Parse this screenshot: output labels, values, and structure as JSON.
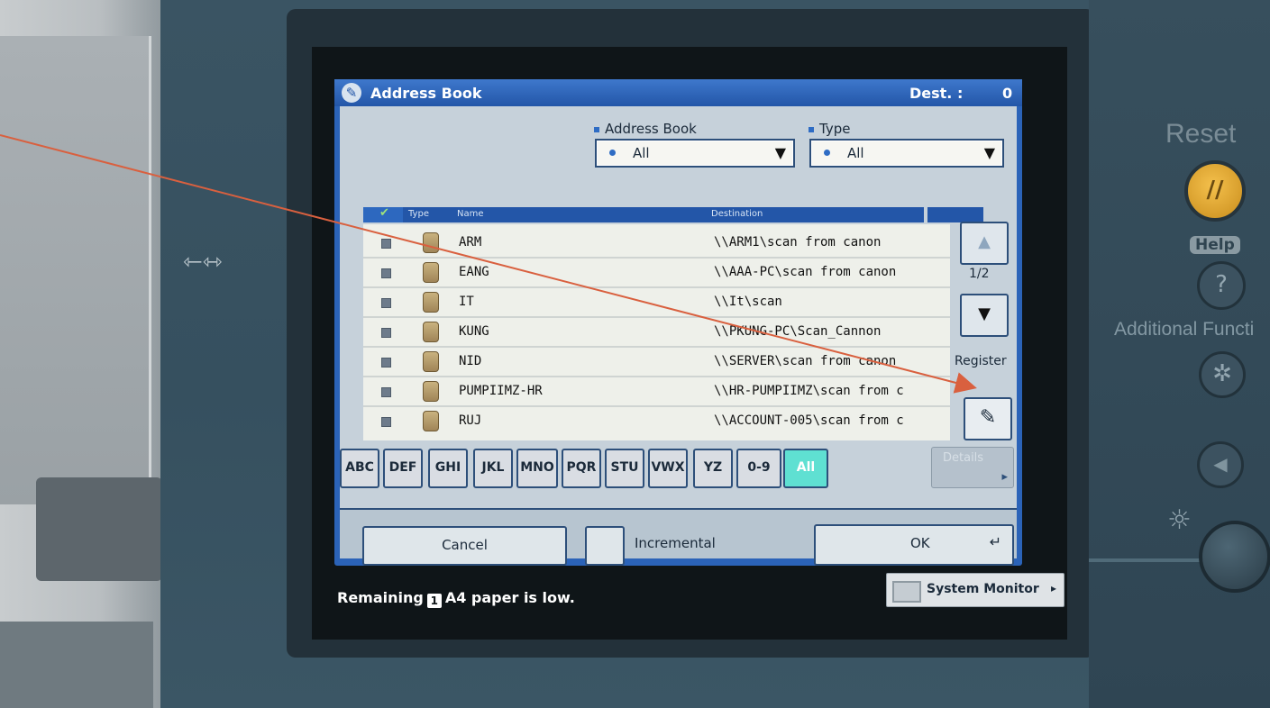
{
  "dialog": {
    "title": "Address Book",
    "dest_label": "Dest. :",
    "dest_value": "0"
  },
  "filters": {
    "address_book": {
      "label": "Address Book",
      "selected": "All"
    },
    "type": {
      "label": "Type",
      "selected": "All"
    }
  },
  "columns": {
    "type": "Type",
    "name": "Name",
    "destination": "Destination"
  },
  "entries": [
    {
      "name": "ARM",
      "destination": "\\\\ARM1\\scan from canon"
    },
    {
      "name": "EANG",
      "destination": "\\\\AAA-PC\\scan from canon"
    },
    {
      "name": "IT",
      "destination": "\\\\It\\scan"
    },
    {
      "name": "KUNG",
      "destination": "\\\\PKUNG-PC\\Scan_Cannon"
    },
    {
      "name": "NID",
      "destination": "\\\\SERVER\\scan from canon"
    },
    {
      "name": "PUMPIIMZ-HR",
      "destination": "\\\\HR-PUMPIIMZ\\scan from c"
    },
    {
      "name": "RUJ",
      "destination": "\\\\ACCOUNT-005\\scan from c"
    }
  ],
  "pagination": {
    "page": "1/2"
  },
  "register": {
    "label": "Register"
  },
  "alpha_tabs": [
    "ABC",
    "DEF",
    "GHI",
    "JKL",
    "MNO",
    "PQR",
    "STU",
    "VWX",
    "YZ",
    "0-9",
    "All"
  ],
  "active_tab": "All",
  "details_button": "Details",
  "buttons": {
    "cancel": "Cancel",
    "incremental": "Incremental",
    "ok": "OK"
  },
  "status": {
    "prefix": "Remaining",
    "badge": "1",
    "suffix": "A4 paper is low."
  },
  "system_monitor": "System Monitor",
  "hardware": {
    "reset": "Reset",
    "help": "Help",
    "additional_functions": "Additional Functi"
  },
  "colors": {
    "title_bar": "#2356a8",
    "active_tab": "#5fe0d2",
    "annotation_arrow": "#d9603f",
    "reset_key": "#e3a936"
  },
  "icons": {
    "title": "address-book-icon",
    "register": "pencil-register-icon",
    "usb": "usb-icon"
  }
}
